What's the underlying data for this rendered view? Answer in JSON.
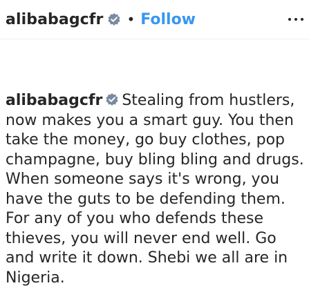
{
  "header": {
    "username": "alibabagcfr",
    "separator": "•",
    "follow_label": "Follow",
    "more_icon": "more-horizontal-icon",
    "verified_icon": "verified-badge-icon"
  },
  "caption": {
    "username": "alibabagcfr",
    "text": "Stealing from hustlers, now makes you a smart guy. You then take the money, go buy clothes, pop champagne, buy bling bling and drugs. When someone says it's wrong, you have the guts to be defending them. For any of you who defends these thieves, you will never end well. Go and write it down. Shebi we all are in Nigeria."
  },
  "colors": {
    "text": "#262626",
    "follow": "#3897f0",
    "badge": "#7a8aa0",
    "divider": "#efefef"
  }
}
